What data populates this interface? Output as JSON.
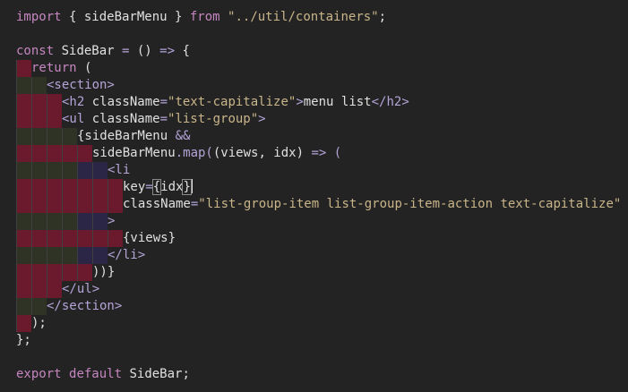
{
  "lines": [
    {
      "indent": [],
      "tokens": [
        {
          "t": "import",
          "c": "tok-kw"
        },
        {
          "t": " { sideBarMenu } ",
          "c": "tok-plain"
        },
        {
          "t": "from",
          "c": "tok-kw"
        },
        {
          "t": " ",
          "c": "tok-plain"
        },
        {
          "t": "\"../util/containers\"",
          "c": "tok-str"
        },
        {
          "t": ";",
          "c": "tok-plain"
        }
      ]
    },
    {
      "indent": [],
      "tokens": []
    },
    {
      "indent": [],
      "tokens": [
        {
          "t": "const",
          "c": "tok-kw"
        },
        {
          "t": " SideBar ",
          "c": "tok-plain"
        },
        {
          "t": "=",
          "c": "tok-op"
        },
        {
          "t": " () ",
          "c": "tok-plain"
        },
        {
          "t": "=>",
          "c": "tok-op"
        },
        {
          "t": " {",
          "c": "tok-plain"
        }
      ]
    },
    {
      "indent": [
        "red"
      ],
      "tokens": [
        {
          "t": "return",
          "c": "tok-kw"
        },
        {
          "t": " (",
          "c": "tok-plain"
        }
      ]
    },
    {
      "indent": [
        "olive",
        "olive"
      ],
      "tokens": [
        {
          "t": "<section>",
          "c": "tok-tag"
        }
      ]
    },
    {
      "indent": [
        "red",
        "red",
        "red"
      ],
      "tokens": [
        {
          "t": "<h2 ",
          "c": "tok-tag"
        },
        {
          "t": "className",
          "c": "tok-attr"
        },
        {
          "t": "=",
          "c": "tok-op"
        },
        {
          "t": "\"text-capitalize\"",
          "c": "tok-str"
        },
        {
          "t": ">",
          "c": "tok-tag"
        },
        {
          "t": "menu list",
          "c": "tok-plain"
        },
        {
          "t": "</h2>",
          "c": "tok-tag"
        }
      ]
    },
    {
      "indent": [
        "red",
        "red",
        "red"
      ],
      "tokens": [
        {
          "t": "<ul ",
          "c": "tok-tag"
        },
        {
          "t": "className",
          "c": "tok-attr"
        },
        {
          "t": "=",
          "c": "tok-op"
        },
        {
          "t": "\"list-group\"",
          "c": "tok-str"
        },
        {
          "t": ">",
          "c": "tok-tag"
        }
      ]
    },
    {
      "indent": [
        "olive",
        "olive",
        "olive",
        "olive"
      ],
      "tokens": [
        {
          "t": "{sideBarMenu ",
          "c": "tok-plain"
        },
        {
          "t": "&&",
          "c": "tok-op"
        }
      ]
    },
    {
      "indent": [
        "red",
        "red",
        "red",
        "red",
        "red"
      ],
      "tokens": [
        {
          "t": "sideBarMenu",
          "c": "tok-plain"
        },
        {
          "t": ".map(",
          "c": "tok-punc"
        },
        {
          "t": "(views, idx) ",
          "c": "tok-plain"
        },
        {
          "t": "=>",
          "c": "tok-op"
        },
        {
          "t": " (",
          "c": "tok-punc"
        }
      ]
    },
    {
      "indent": [
        "olive",
        "olive",
        "olive",
        "olive",
        "navy",
        "navy"
      ],
      "tokens": [
        {
          "t": "<li",
          "c": "tok-tag"
        }
      ]
    },
    {
      "indent": [
        "red",
        "red",
        "red",
        "red",
        "red",
        "red",
        "red"
      ],
      "tokens": [
        {
          "t": "key",
          "c": "tok-attr"
        },
        {
          "t": "=",
          "c": "tok-op"
        },
        {
          "t": "{",
          "c": "tok-plain",
          "box": true
        },
        {
          "t": "idx",
          "c": "tok-plain"
        },
        {
          "t": "}",
          "c": "tok-plain",
          "box": true,
          "cursor": true
        }
      ]
    },
    {
      "indent": [
        "red",
        "red",
        "red",
        "red",
        "red",
        "red",
        "red"
      ],
      "tokens": [
        {
          "t": "className",
          "c": "tok-attr"
        },
        {
          "t": "=",
          "c": "tok-op"
        },
        {
          "t": "\"list-group-item list-group-item-action text-capitalize\"",
          "c": "tok-str"
        }
      ]
    },
    {
      "indent": [
        "olive",
        "olive",
        "olive",
        "olive",
        "navy",
        "navy"
      ],
      "tokens": [
        {
          "t": ">",
          "c": "tok-tag"
        }
      ]
    },
    {
      "indent": [
        "red",
        "red",
        "red",
        "red",
        "red",
        "red",
        "red"
      ],
      "tokens": [
        {
          "t": "{views}",
          "c": "tok-plain"
        }
      ]
    },
    {
      "indent": [
        "olive",
        "olive",
        "olive",
        "olive",
        "navy",
        "navy"
      ],
      "tokens": [
        {
          "t": "</li>",
          "c": "tok-tag"
        }
      ]
    },
    {
      "indent": [
        "red",
        "red",
        "red",
        "red",
        "red"
      ],
      "tokens": [
        {
          "t": "))}",
          "c": "tok-plain"
        }
      ]
    },
    {
      "indent": [
        "red",
        "red",
        "red"
      ],
      "tokens": [
        {
          "t": "</ul>",
          "c": "tok-tag"
        }
      ]
    },
    {
      "indent": [
        "olive",
        "olive"
      ],
      "tokens": [
        {
          "t": "</section>",
          "c": "tok-tag"
        }
      ]
    },
    {
      "indent": [
        "red"
      ],
      "tokens": [
        {
          "t": ");",
          "c": "tok-plain"
        }
      ]
    },
    {
      "indent": [],
      "tokens": [
        {
          "t": "};",
          "c": "tok-plain"
        }
      ]
    },
    {
      "indent": [],
      "tokens": []
    },
    {
      "indent": [],
      "tokens": [
        {
          "t": "export",
          "c": "tok-kw"
        },
        {
          "t": " ",
          "c": "tok-plain"
        },
        {
          "t": "default",
          "c": "tok-kw"
        },
        {
          "t": " SideBar;",
          "c": "tok-plain"
        }
      ]
    }
  ]
}
